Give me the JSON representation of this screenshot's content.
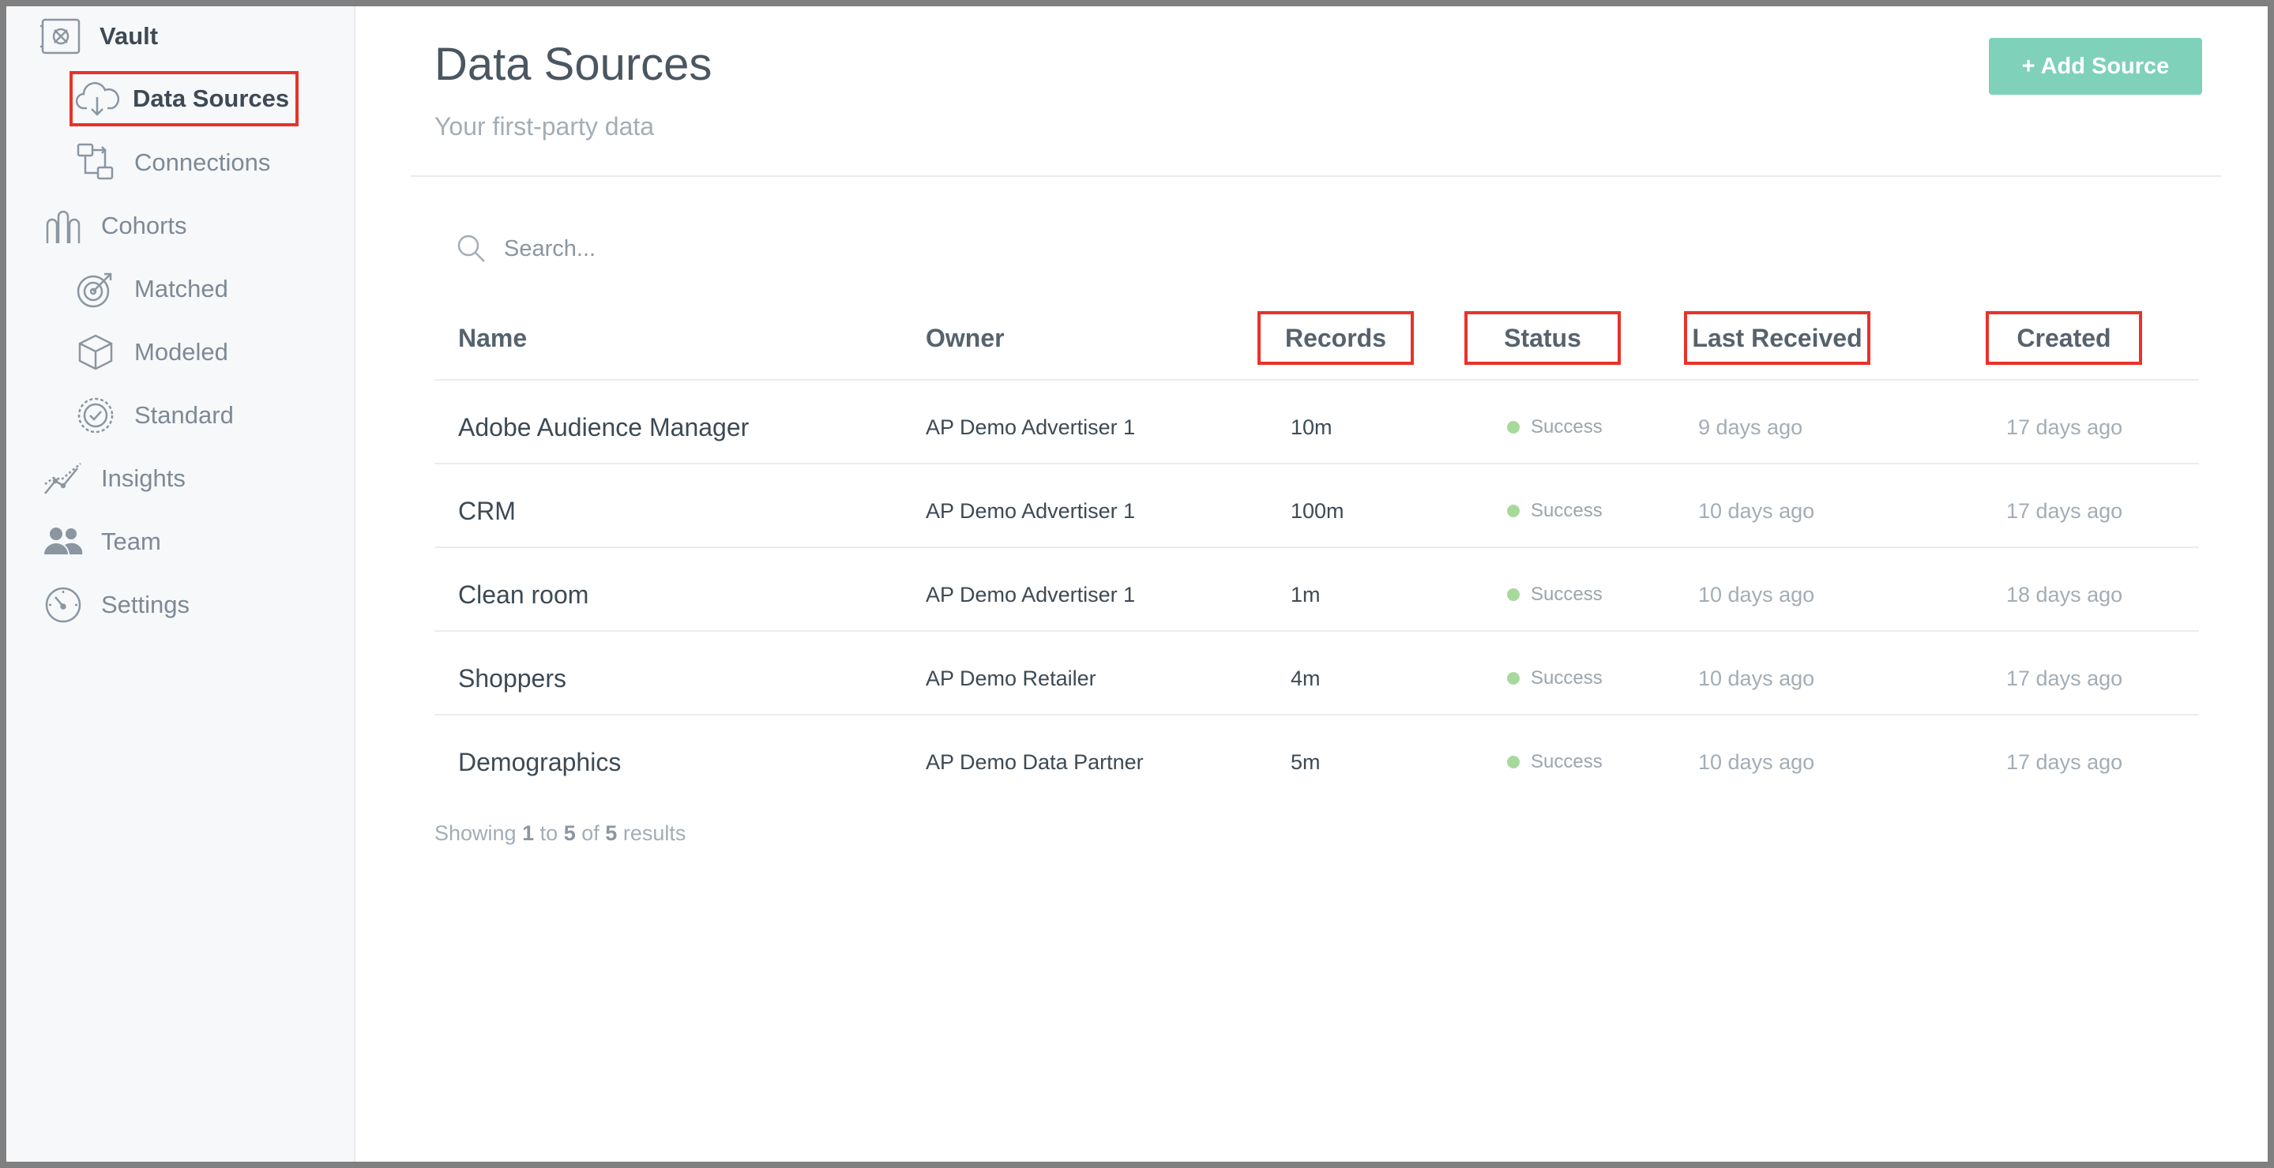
{
  "sidebar": {
    "items": [
      {
        "label": "Vault",
        "icon": "vault-icon"
      },
      {
        "label": "Data Sources",
        "icon": "cloud-download-icon"
      },
      {
        "label": "Connections",
        "icon": "connections-icon"
      },
      {
        "label": "Cohorts",
        "icon": "cohorts-icon"
      },
      {
        "label": "Matched",
        "icon": "target-icon"
      },
      {
        "label": "Modeled",
        "icon": "cube-icon"
      },
      {
        "label": "Standard",
        "icon": "check-badge-icon"
      },
      {
        "label": "Insights",
        "icon": "chart-line-icon"
      },
      {
        "label": "Team",
        "icon": "team-icon"
      },
      {
        "label": "Settings",
        "icon": "gauge-icon"
      }
    ]
  },
  "header": {
    "title": "Data Sources",
    "subtitle": "Your first-party data",
    "add_button": "+ Add Source"
  },
  "search": {
    "placeholder": "Search..."
  },
  "table": {
    "columns": [
      "Name",
      "Owner",
      "Records",
      "Status",
      "Last Received",
      "Created"
    ],
    "rows": [
      {
        "name": "Adobe Audience Manager",
        "owner": "AP Demo Advertiser 1",
        "records": "10m",
        "status": "Success",
        "last_received": "9 days ago",
        "created": "17 days ago"
      },
      {
        "name": "CRM",
        "owner": "AP Demo Advertiser 1",
        "records": "100m",
        "status": "Success",
        "last_received": "10 days ago",
        "created": "17 days ago"
      },
      {
        "name": "Clean room",
        "owner": "AP Demo Advertiser 1",
        "records": "1m",
        "status": "Success",
        "last_received": "10 days ago",
        "created": "18 days ago"
      },
      {
        "name": "Shoppers",
        "owner": "AP Demo Retailer",
        "records": "4m",
        "status": "Success",
        "last_received": "10 days ago",
        "created": "17 days ago"
      },
      {
        "name": "Demographics",
        "owner": "AP Demo Data Partner",
        "records": "5m",
        "status": "Success",
        "last_received": "10 days ago",
        "created": "17 days ago"
      }
    ]
  },
  "footer": {
    "showing": "Showing",
    "start": "1",
    "to": "to",
    "end": "5",
    "of": "of",
    "total": "5",
    "results": "results"
  },
  "colors": {
    "accent": "#7fd1b9",
    "success_dot": "#a8d99c",
    "highlight": "#e8322a"
  }
}
